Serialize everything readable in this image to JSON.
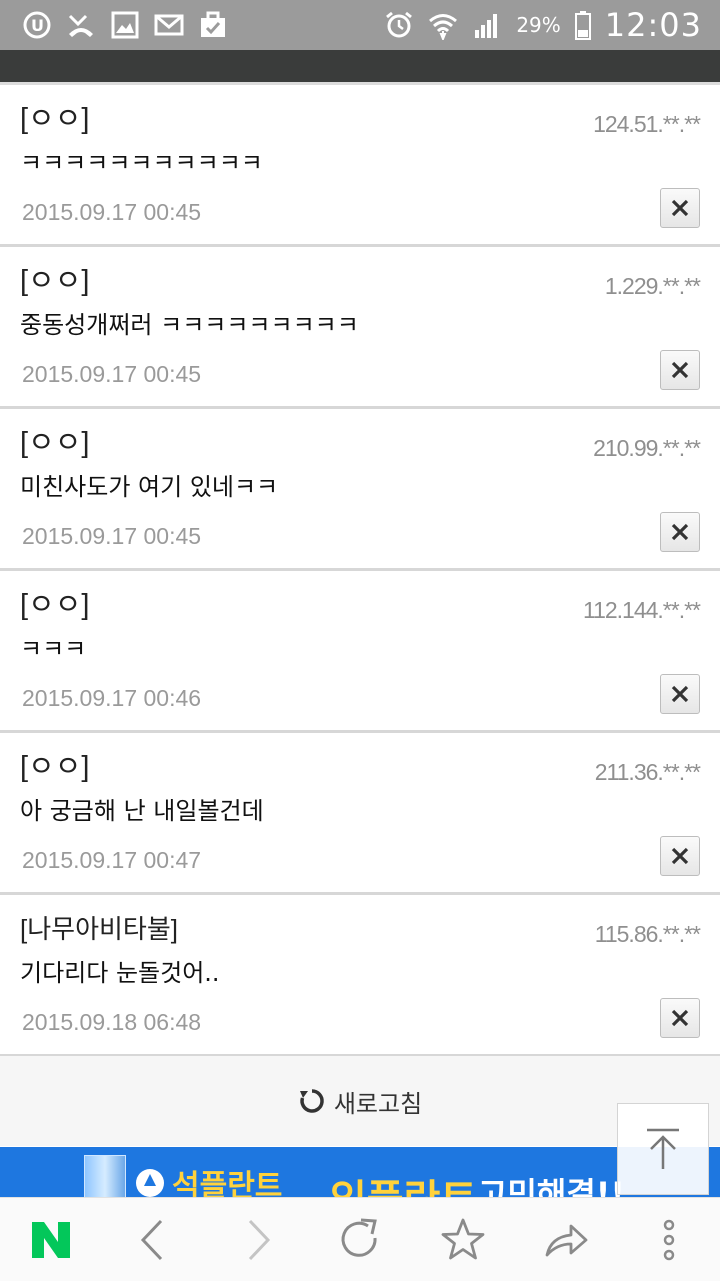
{
  "status_bar": {
    "battery_percent": "29%",
    "time": "12:03",
    "left_icons": [
      "u-plus-icon",
      "missed-call-icon",
      "gallery-icon",
      "mail-icon",
      "clipboard-icon"
    ],
    "right_icons": [
      "alarm-icon",
      "wifi-icon",
      "signal-icon",
      "battery-icon"
    ]
  },
  "comments": [
    {
      "author": "[ㅇㅇ]",
      "ip": "124.51.**.**",
      "text": "ㅋㅋㅋㅋㅋㅋㅋㅋㅋㅋㅋ",
      "date": "2015.09.17 00:45"
    },
    {
      "author": "[ㅇㅇ]",
      "ip": "1.229.**.**",
      "text": "중동성개쩌러 ㅋㅋㅋㅋㅋㅋㅋㅋㅋ",
      "date": "2015.09.17 00:45"
    },
    {
      "author": "[ㅇㅇ]",
      "ip": "210.99.**.**",
      "text": "미친사도가 여기 있네ㅋㅋ",
      "date": "2015.09.17 00:45"
    },
    {
      "author": "[ㅇㅇ]",
      "ip": "112.144.**.**",
      "text": "ㅋㅋㅋ",
      "date": "2015.09.17 00:46"
    },
    {
      "author": "[ㅇㅇ]",
      "ip": "211.36.**.**",
      "text": "아 궁금해 난 내일볼건데",
      "date": "2015.09.17 00:47"
    },
    {
      "author": "[나무아비타불]",
      "ip": "115.86.**.**",
      "text": "기다리다 눈돌것어..",
      "date": "2015.09.18 06:48"
    }
  ],
  "refresh": {
    "label": "새로고침"
  },
  "ad": {
    "text1": "석플란트",
    "text2": "임플란트",
    "text3": "고민해결!!"
  },
  "navbar": {
    "items": [
      "naver-n-icon",
      "back-icon",
      "forward-icon",
      "reload-icon",
      "bookmark-star-icon",
      "share-icon",
      "more-icon"
    ],
    "accent": "#03c75a"
  }
}
